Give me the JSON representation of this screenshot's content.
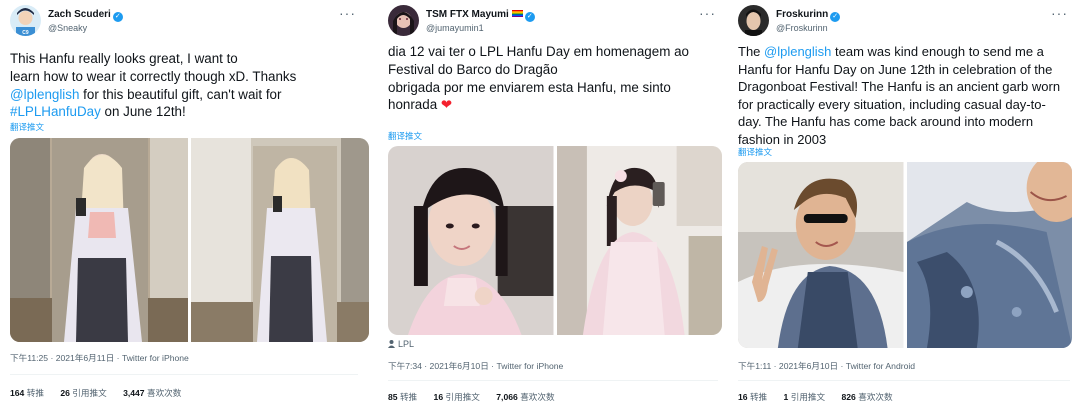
{
  "tweets": [
    {
      "display_name": "Zach Scuderi",
      "handle": "@Sneaky",
      "text_lines": [
        [
          {
            "t": "This Hanfu really looks great, I want to"
          }
        ],
        [
          {
            "t": "learn how to wear it correctly though xD. Thanks"
          }
        ],
        [
          {
            "t": "@lplenglish",
            "link": true
          },
          {
            "t": " for this beautiful gift, can't wait for"
          }
        ],
        [
          {
            "t": "#LPLHanfuDay",
            "link": true
          },
          {
            "t": " on June 12th!"
          }
        ]
      ],
      "translate": "翻译推文",
      "tag": "",
      "meta": "下午11:25 · 2021年6月11日 · ",
      "source": "Twitter for iPhone",
      "retweets_num": "164",
      "retweets_label": "转推",
      "quotes_num": "26",
      "quotes_label": "引用推文",
      "likes_num": "3,447",
      "likes_label": "喜欢次数"
    },
    {
      "display_name": "TSM FTX Mayumi",
      "handle": "@jumayumin1",
      "text_lines": [
        [
          {
            "t": "dia 12 vai ter o LPL Hanfu Day em homenagem ao"
          }
        ],
        [
          {
            "t": "Festival do Barco do Dragão"
          }
        ],
        [
          {
            "t": " "
          }
        ],
        [
          {
            "t": "obrigada por me enviarem esta Hanfu, me sinto"
          }
        ],
        [
          {
            "t": "honrada "
          },
          {
            "t": "❤",
            "heart": true
          }
        ]
      ],
      "translate": "翻译推文",
      "tag": "LPL",
      "meta": "下午7:34 · 2021年6月10日 · ",
      "source": "Twitter for iPhone",
      "retweets_num": "85",
      "retweets_label": "转推",
      "quotes_num": "16",
      "quotes_label": "引用推文",
      "likes_num": "7,066",
      "likes_label": "喜欢次数"
    },
    {
      "display_name": "Froskurinn",
      "handle": "@Froskurinn",
      "text_lines": [
        [
          {
            "t": "The "
          },
          {
            "t": "@lplenglish",
            "link": true
          },
          {
            "t": " team was kind enough to send me a"
          }
        ],
        [
          {
            "t": "Hanfu for Hanfu Day on June 12th in celebration of the"
          }
        ],
        [
          {
            "t": "Dragonboat Festival! The Hanfu is an ancient garb worn"
          }
        ],
        [
          {
            "t": "for practically every situation, including casual day-to-"
          }
        ],
        [
          {
            "t": "day. The Hanfu has come back around into modern"
          }
        ],
        [
          {
            "t": "fashion in 2003"
          }
        ]
      ],
      "translate": "翻译推文",
      "tag": "",
      "meta": "下午1:11 · 2021年6月10日 · ",
      "source": "Twitter for Android",
      "retweets_num": "16",
      "retweets_label": "转推",
      "quotes_num": "1",
      "quotes_label": "引用推文",
      "likes_num": "826",
      "likes_label": "喜欢次数"
    }
  ],
  "colors": {
    "link": "#1d9bf0",
    "muted": "#536471",
    "text": "#0f1419",
    "heart": "#f4212e"
  },
  "icons": {
    "verified": "verified-badge-icon",
    "more": "more-options-icon",
    "tag": "person-tag-icon",
    "flag": "rainbow-flag-icon"
  }
}
